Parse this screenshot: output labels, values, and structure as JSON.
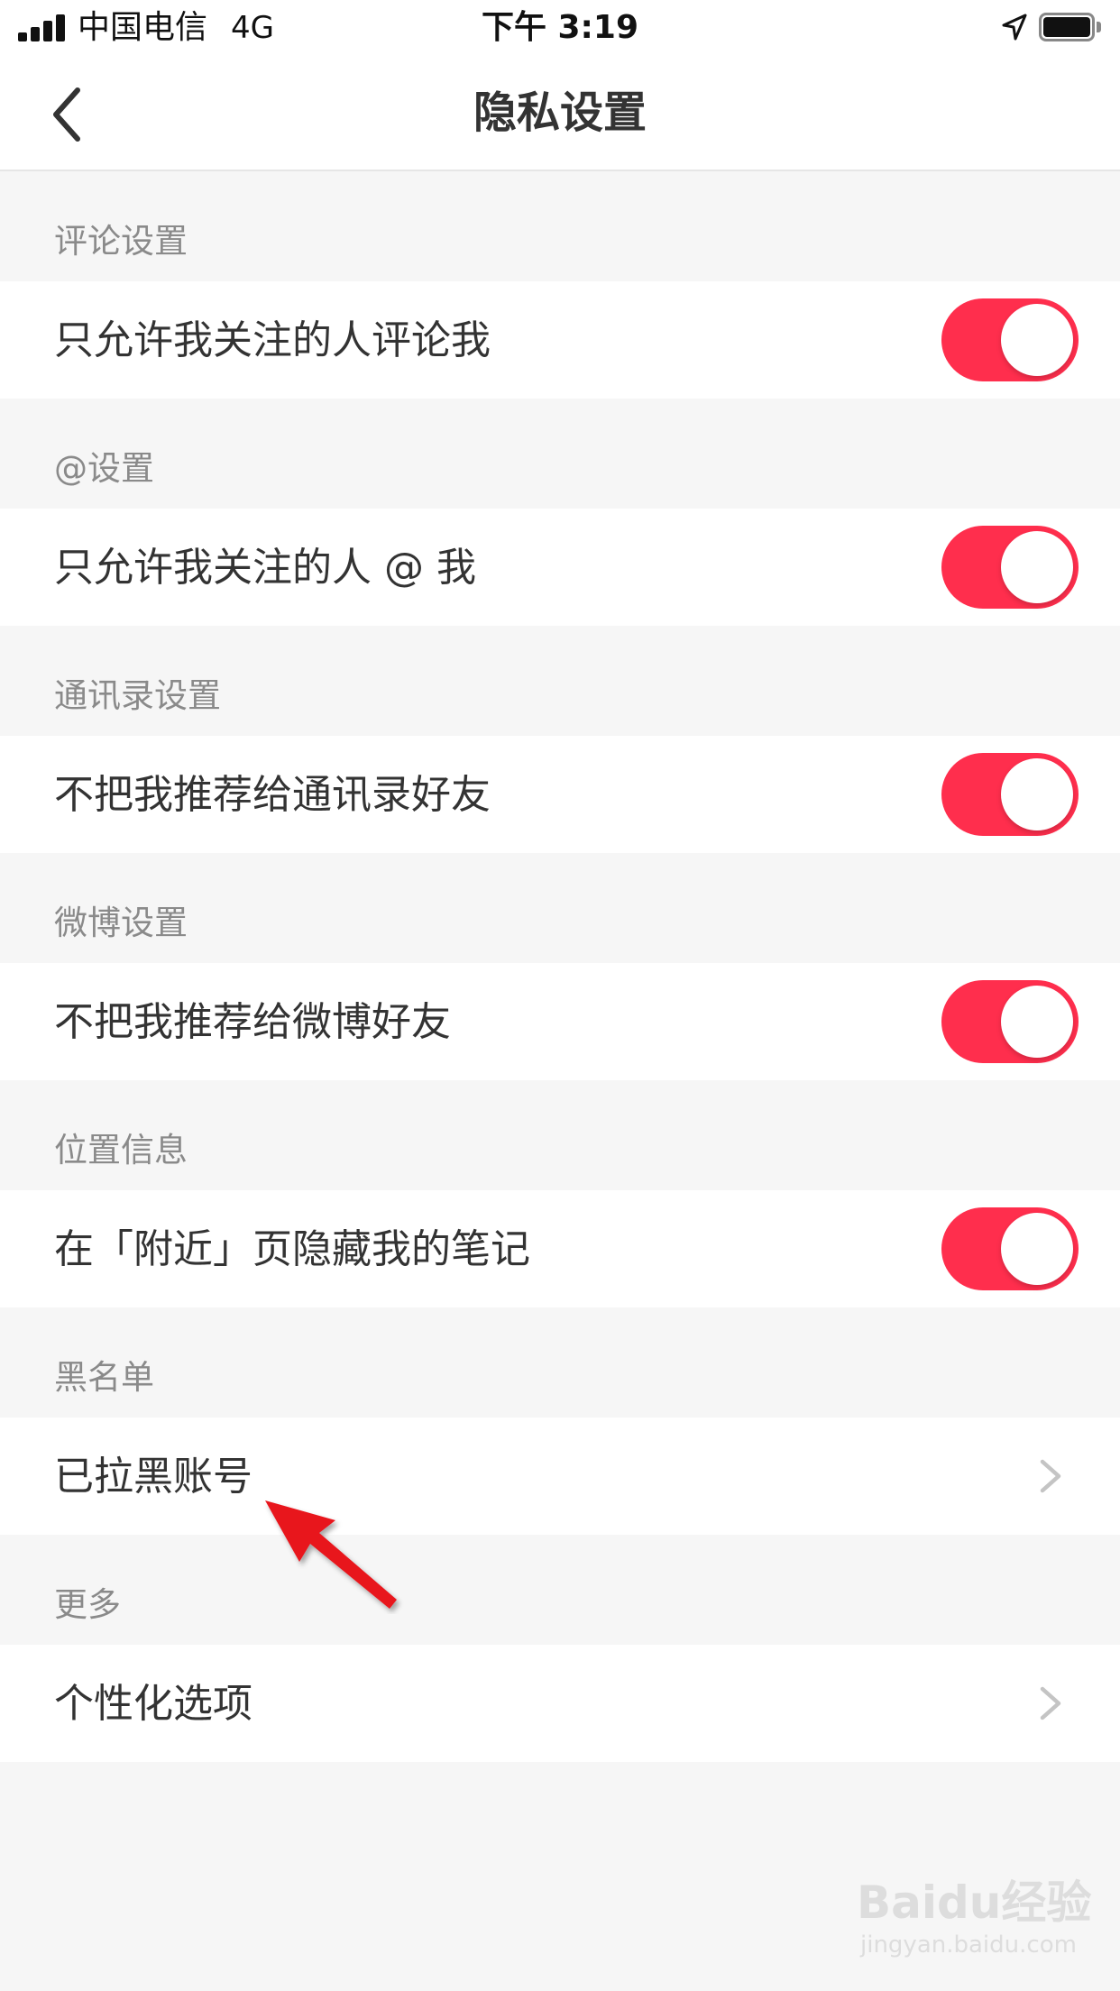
{
  "status_bar": {
    "carrier": "中国电信",
    "network": "4G",
    "time": "下午 3:19"
  },
  "nav": {
    "title": "隐私设置",
    "back_icon": "chevron-left-icon"
  },
  "sections": [
    {
      "header": "评论设置",
      "row": {
        "label": "只允许我关注的人评论我",
        "type": "toggle",
        "on": true
      }
    },
    {
      "header": "@设置",
      "row": {
        "label": "只允许我关注的人 @ 我",
        "type": "toggle",
        "on": true
      }
    },
    {
      "header": "通讯录设置",
      "row": {
        "label": "不把我推荐给通讯录好友",
        "type": "toggle",
        "on": true
      }
    },
    {
      "header": "微博设置",
      "row": {
        "label": "不把我推荐给微博好友",
        "type": "toggle",
        "on": true
      }
    },
    {
      "header": "位置信息",
      "row": {
        "label": "在「附近」页隐藏我的笔记",
        "type": "toggle",
        "on": true
      }
    },
    {
      "header": "黑名单",
      "row": {
        "label": "已拉黑账号",
        "type": "link"
      }
    },
    {
      "header": "更多",
      "row": {
        "label": "个性化选项",
        "type": "link"
      }
    }
  ],
  "colors": {
    "toggle_on": "#ff2e4d",
    "background": "#f6f6f6",
    "row_background": "#ffffff",
    "annotation_arrow": "#e8141e"
  },
  "watermark": {
    "text": "Baidu经验",
    "subtext": "jingyan.baidu.com"
  }
}
